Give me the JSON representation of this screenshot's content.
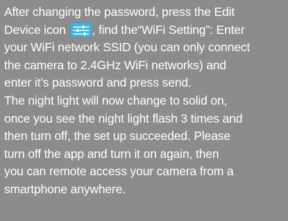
{
  "instructions": {
    "paragraph1": {
      "line1": "After changing the password, press the Edit",
      "line2_before_icon": "Device icon ",
      "line2_after_icon": ", find the“WiFi Setting”: Enter",
      "line3": "your WiFi network SSID (you can only connect",
      "line4": "the camera to 2.4GHz WiFi networks) and",
      "line5": "enter it’s password and press send."
    },
    "paragraph2": {
      "line1": "The night light will now change to solid on,",
      "line2": "once you see the night light flash 3 times and",
      "line3": "then turn off, the set up succeeded. Please",
      "line4": "turn off the app and turn it on again, then",
      "line5": "you can remote access your camera from a",
      "line6": "smartphone anywhere."
    },
    "edit_device_icon": {
      "icon_name": "settings-sliders-icon",
      "background_color": "#34b3e6",
      "line_color": "#ffffff"
    }
  },
  "colors": {
    "background": "#8c8c8c",
    "text": "#ffffff"
  }
}
